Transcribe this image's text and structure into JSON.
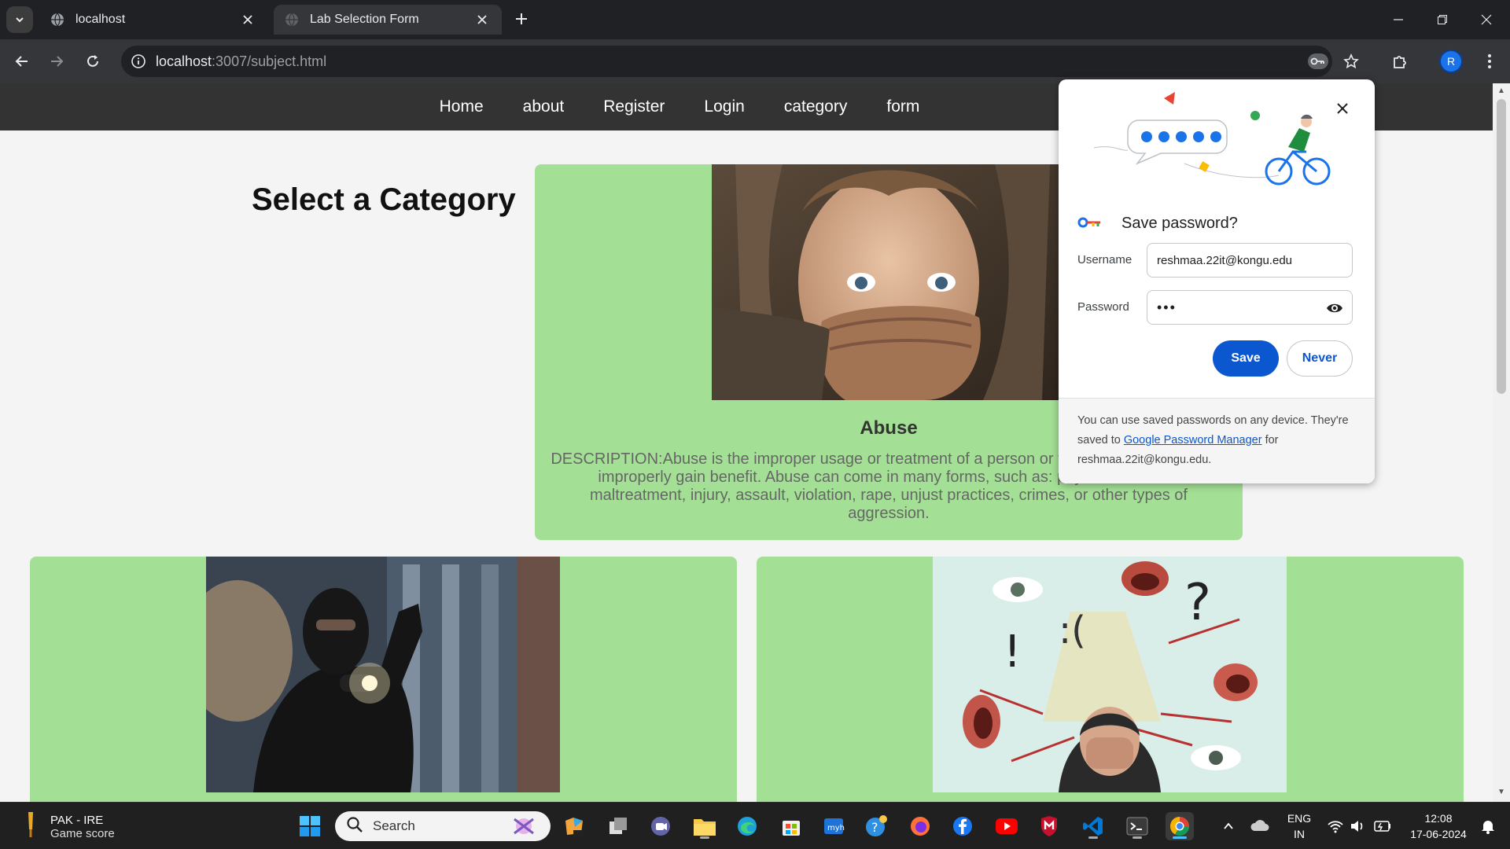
{
  "browser": {
    "tabs": [
      {
        "title": "localhost",
        "active": false
      },
      {
        "title": "Lab Selection Form",
        "active": true
      }
    ],
    "url_host": "localhost",
    "url_path": ":3007/subject.html",
    "profile_initial": "R"
  },
  "site": {
    "nav": [
      "Home",
      "about",
      "Register",
      "Login",
      "category",
      "form"
    ],
    "page_title": "Select a Category",
    "cards": [
      {
        "title": "Abuse",
        "description": "DESCRIPTION:Abuse is the improper usage or treatment of a person or thing, often to unfairly or improperly gain benefit. Abuse can come in many forms, such as: physical or verbal maltreatment, injury, assault, violation, rape, unjust practices, crimes, or other types of aggression."
      },
      {
        "title": "",
        "description": ""
      },
      {
        "title": "",
        "description": ""
      }
    ]
  },
  "password_bubble": {
    "heading": "Save password?",
    "username_label": "Username",
    "username_value": "reshmaa.22it@kongu.edu",
    "password_label": "Password",
    "password_value": "•••",
    "save_label": "Save",
    "never_label": "Never",
    "footer_before": "You can use saved passwords on any device. They're saved to ",
    "footer_link": "Google Password Manager",
    "footer_after": " for reshmaa.22it@kongu.edu."
  },
  "taskbar": {
    "weather_line1": "PAK - IRE",
    "weather_line2": "Game score",
    "search_placeholder": "Search",
    "lang_line1": "ENG",
    "lang_line2": "IN",
    "time": "12:08",
    "date": "17-06-2024"
  },
  "colors": {
    "card_bg": "#a3e095",
    "nav_bg": "#333333",
    "save_button": "#0b57d0"
  }
}
